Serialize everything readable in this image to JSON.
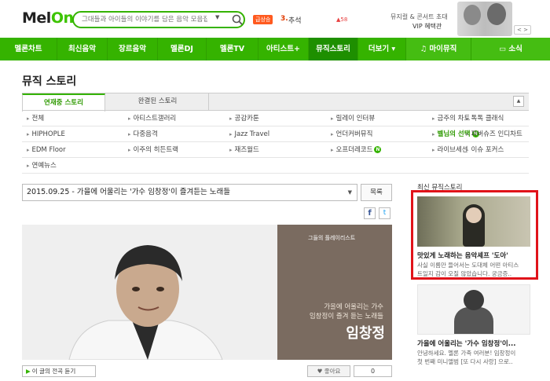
{
  "header": {
    "logo_main": "Mel",
    "logo_accent": "On",
    "search_placeholder": "그대들과 아이들의 이야기를 담은 음악 모음집",
    "search_dropdown": "▼",
    "rising_badge": "급상승",
    "rising_rank": "3.",
    "rising_title": "추석",
    "rising_change": "▲58",
    "promo_line1": "뮤지컬 & 콘서트 초대",
    "promo_line2": "VIP 혜택관",
    "promo_nav": "< >"
  },
  "nav": {
    "items": [
      {
        "label": "멜론차트"
      },
      {
        "label": "최신음악"
      },
      {
        "label": "장르음악"
      },
      {
        "label": "멜론DJ"
      },
      {
        "label": "멜론TV"
      },
      {
        "label": "아티스트+"
      },
      {
        "label": "뮤직스토리"
      },
      {
        "label": "더보기 ▾"
      },
      {
        "label": "♫ 마이뮤직"
      },
      {
        "label": "▭ 소식"
      }
    ]
  },
  "page": {
    "title": "뮤직 스토리"
  },
  "tabs": {
    "active": "연재중 스토리",
    "other": "완결된 스토리",
    "collapse": "▲"
  },
  "categories": [
    [
      "전체",
      "아티스트갤러리",
      "공감카툰",
      "릴레이 인터뷰",
      "금주의 차트",
      "톡톡 클래식"
    ],
    [
      "HIPHOPLE",
      "다중음격",
      "Jazz Travel",
      "언더커버뮤직",
      "벨님의 선택",
      "피버슈즈 인디차트"
    ],
    [
      "EDM Floor",
      "이주의 히든트랙",
      "재즈월드",
      "오프더레코드",
      "라이브세션",
      "이슈 포커스"
    ],
    [
      "연예뉴스"
    ]
  ],
  "category_new": "N",
  "story": {
    "selected": "2015.09.25 - 가을에 어울리는 '가수 임창정'이 즐겨듣는 노래들",
    "caret": "▼",
    "list_button": "목록"
  },
  "share": {
    "facebook": "f",
    "twitter": "t"
  },
  "hero": {
    "small_label": "그들의 플레이리스트",
    "line1": "가을에 어울리는 가수",
    "line2": "임창정이 즐겨 듣는 노래들",
    "name": "임창정"
  },
  "bottom": {
    "listen_label": "이 글의 전곡 듣기",
    "like_label": "♥ 좋아요",
    "like_count": "0"
  },
  "sidebar": {
    "title": "최신 뮤직스토리",
    "items": [
      {
        "title": "맛있게 노래하는 음악셰프 '도아'",
        "desc1": "사실 이름만 들어서는 도대체 어떤 아티스",
        "desc2": "트일지 감이 오질 않았습니다. 궁금증.."
      },
      {
        "title": "가을에 어울리는 '가수 임창정'이...",
        "desc1": "안녕하세요. 멜론 가족 여러분! 임창정이",
        "desc2": "첫 번째 미니앨범 [또 다시 사랑] 으로.."
      }
    ]
  },
  "colors": {
    "brand_green": "#35b300",
    "highlight_red": "#e0131a"
  }
}
